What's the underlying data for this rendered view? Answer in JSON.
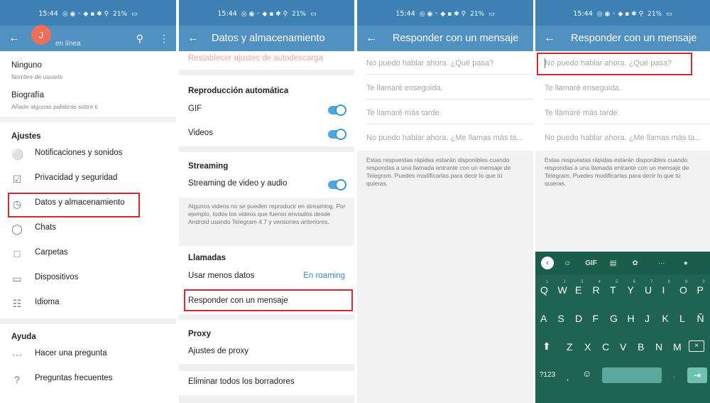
{
  "status": {
    "time": "15:44",
    "battery": "21%"
  },
  "panel1": {
    "avatar_letter": "J",
    "online": "en línea",
    "username_value": "Ninguno",
    "username_label": "Nombre de usuario",
    "bio_title": "Biografía",
    "bio_hint": "Añade algunas palabras sobre ti",
    "section_settings": "Ajustes",
    "items": [
      {
        "label": "Notificaciones y sonidos",
        "icon": "bell-icon"
      },
      {
        "label": "Privacidad y seguridad",
        "icon": "lock-icon"
      },
      {
        "label": "Datos y almacenamiento",
        "icon": "clock-icon"
      },
      {
        "label": "Chats",
        "icon": "chat-bubble-icon"
      },
      {
        "label": "Carpetas",
        "icon": "folder-icon"
      },
      {
        "label": "Dispositivos",
        "icon": "laptop-icon"
      },
      {
        "label": "Idioma",
        "icon": "globe-icon"
      }
    ],
    "section_help": "Ayuda",
    "help_items": [
      {
        "label": "Hacer una pregunta",
        "icon": "chat-dots-icon"
      },
      {
        "label": "Preguntas frecuentes",
        "icon": "question-icon"
      }
    ]
  },
  "panel2": {
    "title": "Datos y almacenamiento",
    "reset_autodownload": "Restablecer ajustes de autodescarga",
    "section_autoplay": "Reproducción automática",
    "gif": "GIF",
    "videos": "Videos",
    "section_streaming": "Streaming",
    "streaming_label": "Streaming de video y audio",
    "streaming_note": "Algunos videos no se pueden reproducir en streaming. Por ejemplo, todos los videos que fueron enviados desde Android usando Telegram 4.7 y versiones anteriores.",
    "section_calls": "Llamadas",
    "less_data": "Usar menos datos",
    "less_data_value": "En roaming",
    "reply_message": "Responder con un mensaje",
    "section_proxy": "Proxy",
    "proxy_settings": "Ajustes de proxy",
    "delete_drafts": "Eliminar todos los borradores"
  },
  "panel3": {
    "title": "Responder con un mensaje",
    "replies": [
      "No puedo hablar ahora. ¿Qué pasa?",
      "Te llamaré enseguida.",
      "Te llamaré más tarde.",
      "No puedo hablar ahora. ¿Me llamas más ta..."
    ],
    "note": "Estas respuestas rápidas estarán disponibles cuando respondas a una llamada entrante con un mensaje de Telegram. Puedes modificarlas para decir lo que tú quieras."
  },
  "keyboard": {
    "gif": "GIF",
    "row1": [
      "Q",
      "W",
      "E",
      "R",
      "T",
      "Y",
      "U",
      "I",
      "O",
      "P"
    ],
    "row1_hints": [
      "1",
      "2",
      "3",
      "4",
      "5",
      "6",
      "7",
      "8",
      "9",
      "0"
    ],
    "row2": [
      "A",
      "S",
      "D",
      "F",
      "G",
      "H",
      "J",
      "K",
      "L",
      "Ñ"
    ],
    "row3": [
      "Z",
      "X",
      "C",
      "V",
      "B",
      "N",
      "M"
    ],
    "sym": "?123",
    "comma": ",",
    "period": "."
  },
  "colors": {
    "header": "#5191c2",
    "status": "#3d81b4",
    "accent": "#3a87c6",
    "highlight": "#d9262f",
    "keyboard": "#1f6352"
  }
}
